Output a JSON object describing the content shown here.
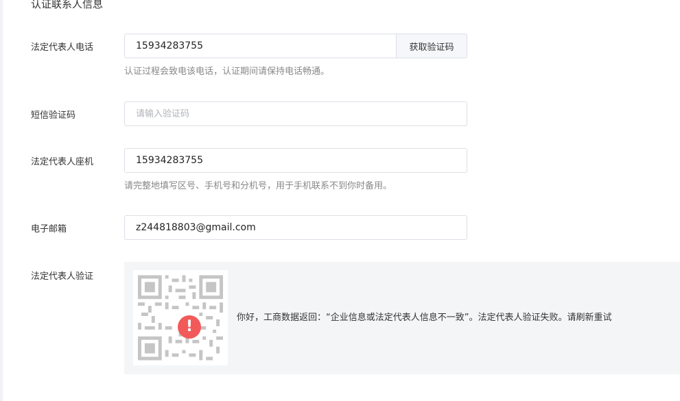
{
  "section": {
    "title": "认证联系人信息"
  },
  "phone": {
    "label": "法定代表人电话",
    "value": "15934283755",
    "get_code_label": "获取验证码",
    "hint": "认证过程会致电该电话，认证期间请保持电话畅通。"
  },
  "sms": {
    "label": "短信验证码",
    "placeholder": "请输入验证码"
  },
  "landline": {
    "label": "法定代表人座机",
    "value": "15934283755",
    "hint": "请完整地填写区号、手机号和分机号，用于手机联系不到你时备用。"
  },
  "email": {
    "label": "电子邮箱",
    "value": "z244818803@gmail.com"
  },
  "verification": {
    "label": "法定代表人验证",
    "warning_glyph": "!",
    "message": "你好，工商数据返回：“企业信息或法定代表人信息不一致”。法定代表人验证失败。请",
    "refresh_label": "刷新重试",
    "warning_color": "#f25a5a"
  }
}
